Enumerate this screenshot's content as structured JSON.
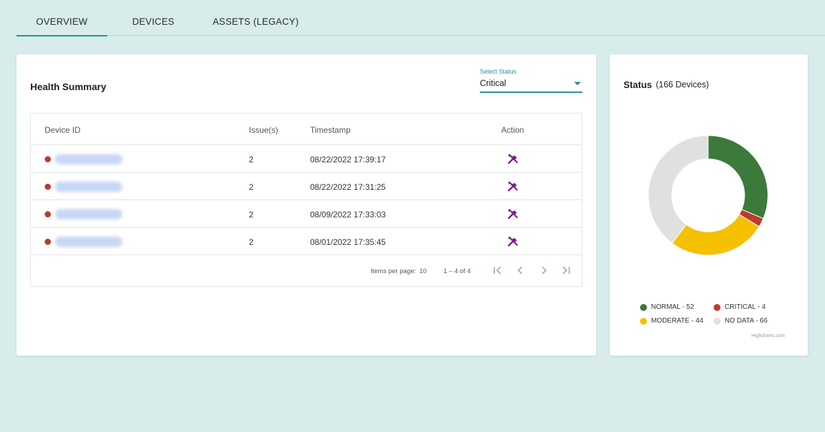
{
  "tabs": [
    {
      "label": "OVERVIEW",
      "active": true
    },
    {
      "label": "DEVICES",
      "active": false
    },
    {
      "label": "ASSETS (LEGACY)",
      "active": false
    }
  ],
  "health_summary": {
    "title": "Health Summary",
    "select": {
      "label": "Select Status",
      "value": "Critical"
    },
    "columns": [
      "Device ID",
      "Issue(s)",
      "Timestamp",
      "Action"
    ],
    "rows": [
      {
        "issues": "2",
        "timestamp": "08/22/2022 17:39:17",
        "status_color": "#c0392b"
      },
      {
        "issues": "2",
        "timestamp": "08/22/2022 17:31:25",
        "status_color": "#c0392b"
      },
      {
        "issues": "2",
        "timestamp": "08/09/2022 17:33:03",
        "status_color": "#c0392b"
      },
      {
        "issues": "2",
        "timestamp": "08/01/2022 17:35:45",
        "status_color": "#c0392b"
      }
    ],
    "pager": {
      "items_per_page_label": "Items per page:",
      "items_per_page": "10",
      "range": "1 – 4 of 4"
    }
  },
  "status": {
    "title": "Status",
    "subtitle": "(166 Devices)",
    "credits": "Highcharts.com"
  },
  "chart_data": {
    "type": "pie",
    "title": "Status",
    "subtitle": "(166 Devices)",
    "categories": [
      "NORMAL",
      "CRITICAL",
      "MODERATE",
      "NO DATA"
    ],
    "values": [
      52,
      4,
      44,
      66
    ],
    "colors": [
      "#3b7a3b",
      "#c0392b",
      "#f5c000",
      "#e0e0e0"
    ],
    "legend_labels": [
      "NORMAL - 52",
      "CRITICAL - 4",
      "MODERATE - 44",
      "NO DATA - 66"
    ],
    "legend_placement": "bottom"
  },
  "colors": {
    "accent": "#2a8f8f",
    "background": "#d8ecec",
    "action_icon": "#7a1f8a",
    "critical": "#c0392b"
  },
  "icons": {
    "action": "wrench-screwdriver-icon",
    "pager": [
      "first-page-icon",
      "prev-page-icon",
      "next-page-icon",
      "last-page-icon"
    ]
  }
}
